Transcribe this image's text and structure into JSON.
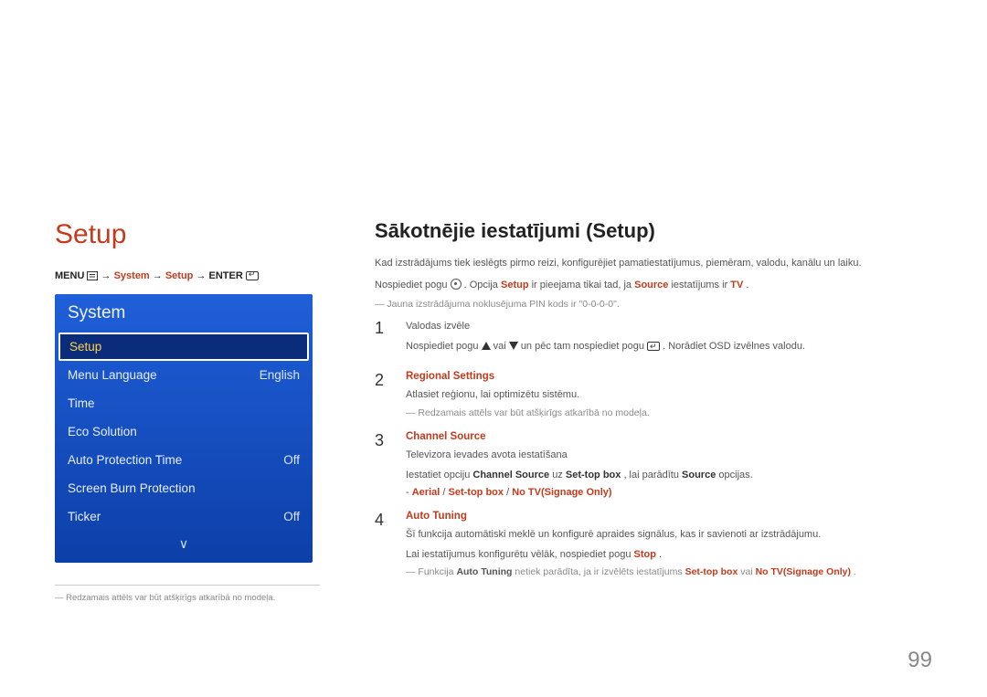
{
  "left": {
    "heading": "Setup",
    "breadcrumb": {
      "menu": "MENU",
      "arrow": "→",
      "p1": "System",
      "p2": "Setup",
      "enter": "ENTER"
    },
    "panel": {
      "title": "System",
      "items": [
        {
          "label": "Setup",
          "value": "",
          "selected": true
        },
        {
          "label": "Menu Language",
          "value": "English",
          "selected": false
        },
        {
          "label": "Time",
          "value": "",
          "selected": false
        },
        {
          "label": "Eco Solution",
          "value": "",
          "selected": false
        },
        {
          "label": "Auto Protection Time",
          "value": "Off",
          "selected": false
        },
        {
          "label": "Screen Burn Protection",
          "value": "",
          "selected": false
        },
        {
          "label": "Ticker",
          "value": "Off",
          "selected": false
        }
      ],
      "more": "∨"
    },
    "note": "Redzamais attēls var būt atšķirīgs atkarībā no modeļa."
  },
  "right": {
    "heading": "Sākotnējie iestatījumi (Setup)",
    "p1": "Kad izstrādājums tiek ieslēgts pirmo reizi, konfigurējiet pamatiestatījumus, piemēram, valodu, kanālu un laiku.",
    "p2a": "Nospiediet pogu ",
    "p2b": ". Opcija ",
    "p2_setup": "Setup",
    "p2c": " ir pieejama tikai tad, ja ",
    "p2_source": "Source",
    "p2d": " iestatījums ir ",
    "p2_tv": "TV",
    "p2e": ".",
    "note1": "Jauna izstrādājuma noklusējuma PIN kods ir \"0-0-0-0\".",
    "steps": [
      {
        "title_plain": "Valodas izvēle",
        "lines": [
          {
            "pre": "Nospiediet pogu ",
            "mid1": " vai ",
            "mid2": " un pēc tam nospiediet pogu ",
            "post": ". Norādiet OSD izvēlnes valodu."
          }
        ]
      },
      {
        "title_hl": "Regional Settings",
        "text1": "Atlasiet reģionu, lai optimizētu sistēmu.",
        "dash1": "Redzamais attēls var būt atšķirīgs atkarībā no modeļa."
      },
      {
        "title_hl": "Channel Source",
        "text1": "Televizora ievades avota iestatīšana",
        "text2a": "Iestatiet opciju ",
        "text2_cs": "Channel Source",
        "text2b": " uz ",
        "text2_stb": "Set-top box",
        "text2c": ", lai parādītu ",
        "text2_src": "Source",
        "text2d": " opcijas.",
        "bullet": {
          "a": "Aerial",
          "sep": " / ",
          "b": "Set-top box",
          "c": "No TV(Signage Only)"
        }
      },
      {
        "title_hl": "Auto Tuning",
        "text1": "Šī funkcija automātiski meklē un konfigurē apraides signālus, kas ir savienoti ar izstrādājumu.",
        "text2a": "Lai iestatījumus konfigurētu vēlāk, nospiediet pogu ",
        "text2_stop": "Stop",
        "text2b": ".",
        "dash_a": "Funkcija ",
        "dash_at": "Auto Tuning",
        "dash_b": " netiek parādīta, ja ir izvēlēts iestatījums ",
        "dash_stb": "Set-top box",
        "dash_c": " vai ",
        "dash_ntv": "No TV(Signage Only)",
        "dash_d": "."
      }
    ]
  },
  "pageNumber": "99"
}
